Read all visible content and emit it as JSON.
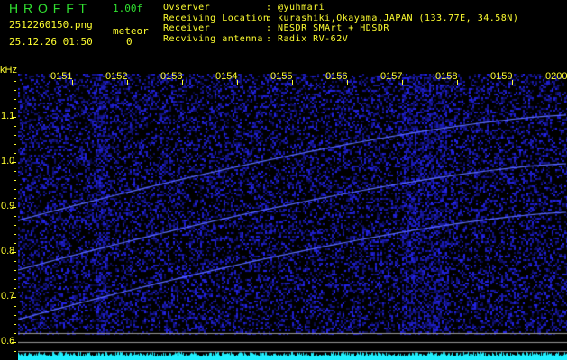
{
  "header": {
    "logo": "H R O F F T",
    "version": "1.00f",
    "filename": "2512260150.png",
    "datetime": "25.12.26 01:50",
    "meteor_label": "meteor",
    "meteor_count": "0"
  },
  "info": [
    {
      "label": "Ovserver",
      "value": "@yuhmari"
    },
    {
      "label": "Receiving Location",
      "value": "kurashiki,Okayama,JAPAN (133.77E, 34.58N)"
    },
    {
      "label": "Receiver",
      "value": "NESDR SMArt + HDSDR"
    },
    {
      "label": "Recviving antenna",
      "value": "Radix RV-62V"
    }
  ],
  "axis": {
    "unit": "kHz",
    "y_labels": [
      "1.1",
      "1.0",
      "0.9",
      "0.8",
      "0.7",
      "0.6"
    ],
    "x_labels": [
      "0151",
      "0152",
      "0153",
      "0154",
      "0155",
      "0156",
      "0157",
      "0158",
      "0159",
      "0200"
    ]
  },
  "colors": {
    "text": "#ffff30",
    "logo": "#30e030",
    "signal": "#4060ff",
    "level": "#20f0ff"
  }
}
